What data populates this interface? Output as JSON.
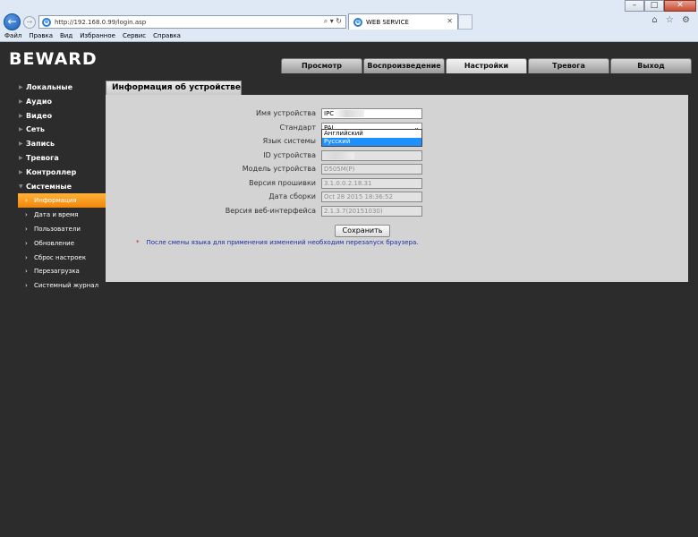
{
  "browser": {
    "window_buttons": {
      "minimize": "–",
      "maximize": "□",
      "close": "✕"
    },
    "url": "http://192.168.0.99/login.asp",
    "address_tools": "⌕ ▾ ↻",
    "tab_title": "WEB SERVICE",
    "tab_close": "✕",
    "toolbar_icons": "⌂ ☆ ⚙",
    "menu": [
      "Файл",
      "Правка",
      "Вид",
      "Избранное",
      "Сервис",
      "Справка"
    ]
  },
  "app": {
    "logo": "BEWARD",
    "top_tabs": [
      {
        "label": "Просмотр"
      },
      {
        "label": "Воспроизведение"
      },
      {
        "label": "Настройки"
      },
      {
        "label": "Тревога"
      },
      {
        "label": "Выход"
      }
    ],
    "active_top_tab": "Настройки"
  },
  "sidebar": {
    "groups": [
      "Локальные",
      "Аудио",
      "Видео",
      "Сеть",
      "Запись",
      "Тревога",
      "Контроллер",
      "Системные"
    ],
    "sub_items": [
      "Информация",
      "Дата и время",
      "Пользователи",
      "Обновление",
      "Сброс настроек",
      "Перезагрузка",
      "Системный журнал"
    ],
    "active_sub_item": "Информация"
  },
  "content": {
    "tab_title": "Информация об устройстве",
    "fields": {
      "device_name": {
        "label": "Имя устройства",
        "value": "IPC"
      },
      "standard": {
        "label": "Стандарт",
        "value": "PAL"
      },
      "system_language": {
        "label": "Язык системы"
      },
      "device_id": {
        "label": "ID устройства"
      },
      "device_model": {
        "label": "Модель устройства",
        "value": "D505M(P)"
      },
      "firmware_version": {
        "label": "Версия прошивки",
        "value": "3.1.0.0.2.18.31"
      },
      "build_date": {
        "label": "Дата сборки",
        "value": "Oct 28 2015  18:36:52"
      },
      "web_version": {
        "label": "Версия веб-интерфейса",
        "value": "2.1.3.7(20151030)"
      }
    },
    "language_options": [
      "Английский",
      "Русский"
    ],
    "language_selected": "Русский",
    "save_label": "Сохранить",
    "note_star": "*",
    "note": "После смены языка для применения изменений необходим перезапуск браузера."
  }
}
